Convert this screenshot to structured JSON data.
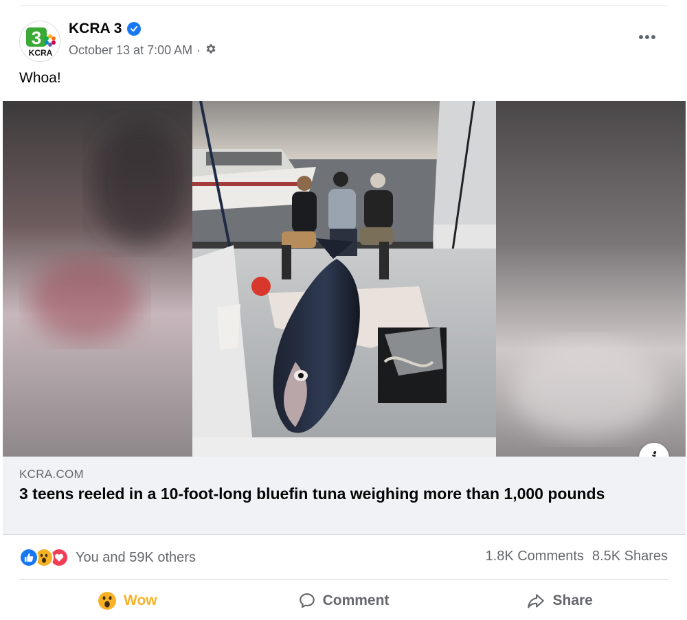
{
  "post": {
    "page_name": "KCRA 3",
    "timestamp": "October 13 at 7:00 AM",
    "separator": "·",
    "caption": "Whoa!",
    "avatar": {
      "logo_number": "3",
      "logo_text": "KCRA"
    }
  },
  "link_preview": {
    "domain": "KCRA.COM",
    "headline": "3 teens reeled in a 10-foot-long bluefin tuna weighing more than 1,000 pounds",
    "info_label": "i"
  },
  "engagement": {
    "reaction_icons": [
      "like-icon",
      "wow-icon",
      "love-icon"
    ],
    "reactions_text": "You and 59K others",
    "comments": "1.8K Comments",
    "shares": "8.5K Shares"
  },
  "actions": {
    "wow_label": "Wow",
    "comment_label": "Comment",
    "share_label": "Share"
  },
  "colors": {
    "accent": "#1877f2",
    "wow": "#f7b125",
    "secondary_text": "#65676b",
    "preview_bg": "#f0f2f5",
    "love": "#f33e58"
  }
}
